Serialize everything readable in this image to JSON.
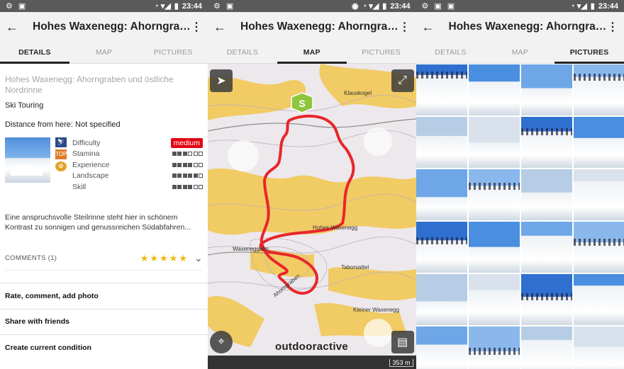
{
  "status": {
    "time": "23:44"
  },
  "app": {
    "title": "Hohes Waxenegg: Ahorngraben und östliche Nordrinne",
    "title_short": "Hohes Waxenegg: Ahorngrab…",
    "tabs": [
      "DETAILS",
      "MAP",
      "PICTURES"
    ]
  },
  "details": {
    "title": "Hohes Waxenegg: Ahorngraben und östliche Nordrinne",
    "category": "Ski Touring",
    "distance": "Distance from here: Not specified",
    "ratings": [
      {
        "label": "Difficulty",
        "value": "medium"
      },
      {
        "label": "Stamina",
        "level": 3,
        "max": 6
      },
      {
        "label": "Experience",
        "level": 4,
        "max": 6
      },
      {
        "label": "Landscape",
        "level": 5,
        "max": 6
      },
      {
        "label": "Skill",
        "level": 4,
        "max": 6
      }
    ],
    "description": "Eine anspruchsvolle Steilrinne steht hier in schönem Kontrast zu sonnigen und genussreichen Südabfahren...",
    "comments_label": "COMMENTS (1)",
    "stars": 5,
    "actions": [
      "Rate, comment, add photo",
      "Share with friends",
      "Create current condition"
    ]
  },
  "map": {
    "labels": [
      "Klauskogel",
      "Hohes Waxenegg",
      "Waxeneggalm",
      "Ahorngraben",
      "Taborsattel",
      "Kleiner Waxenegg"
    ],
    "start_marker": "S",
    "brand": "outdooractive",
    "scale": "353 m"
  },
  "colors": {
    "accent": "#e30613",
    "route": "#e8262a",
    "star": "#f2b705"
  }
}
